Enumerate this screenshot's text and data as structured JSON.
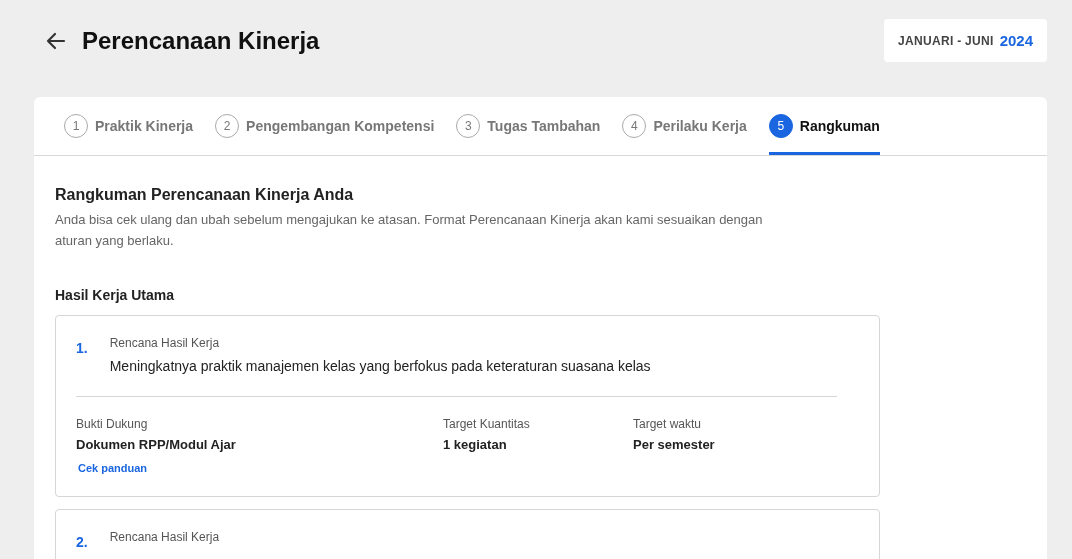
{
  "header": {
    "title": "Perencanaan Kinerja",
    "period": {
      "range": "JANUARI - JUNI",
      "year": "2024"
    }
  },
  "tabs": [
    {
      "number": "1",
      "label": "Praktik Kinerja",
      "selected": false
    },
    {
      "number": "2",
      "label": "Pengembangan Kompetensi",
      "selected": false
    },
    {
      "number": "3",
      "label": "Tugas Tambahan",
      "selected": false
    },
    {
      "number": "4",
      "label": "Perilaku Kerja",
      "selected": false
    },
    {
      "number": "5",
      "label": "Rangkuman",
      "selected": true
    }
  ],
  "summary": {
    "title": "Rangkuman Perencanaan Kinerja Anda",
    "description": "Anda bisa cek ulang dan ubah sebelum mengajukan ke atasan. Format Perencanaan Kinerja akan kami sesuaikan dengan aturan yang berlaku."
  },
  "section": {
    "title": "Hasil Kerja Utama",
    "items": [
      {
        "number": "1.",
        "label": "Rencana Hasil Kerja",
        "text": "Meningkatnya praktik manajemen kelas yang berfokus pada keteraturan suasana kelas",
        "fields": [
          {
            "label": "Bukti Dukung",
            "value": "Dokumen RPP/Modul Ajar",
            "link": "Cek panduan"
          },
          {
            "label": "Target Kuantitas",
            "value": "1 kegiatan"
          },
          {
            "label": "Target waktu",
            "value": "Per semester"
          }
        ]
      },
      {
        "number": "2.",
        "label": "Rencana Hasil Kerja"
      }
    ]
  }
}
